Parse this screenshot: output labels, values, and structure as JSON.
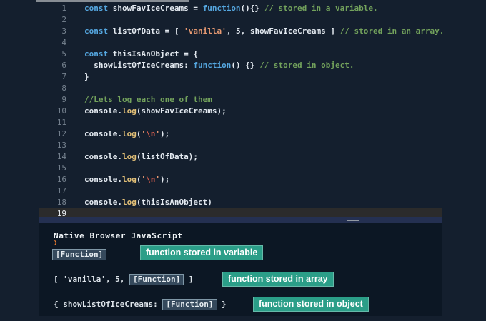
{
  "colors": {
    "page_bg": "#141f2e",
    "console_bg": "#0c1724",
    "active_line_bg": "#2b2b2b",
    "keyword": "#55a7e0",
    "plain_text": "#e3e9f0",
    "comment": "#73a25c",
    "string": "#e89a72",
    "escape": "#d95f4e",
    "method": "#e3c077",
    "badge_bg": "#2b9e88",
    "prompt_icon": "#ee7c2e"
  },
  "editor": {
    "lines": [
      {
        "num": "1",
        "tokens": [
          [
            "kw",
            "const"
          ],
          [
            "pl",
            " showFavIceCreams = "
          ],
          [
            "kw",
            "function"
          ],
          [
            "pl",
            "(){} "
          ],
          [
            "cm",
            "// stored in a variable."
          ]
        ]
      },
      {
        "num": "2",
        "tokens": []
      },
      {
        "num": "3",
        "tokens": [
          [
            "kw",
            "const"
          ],
          [
            "pl",
            " listOfData = [ "
          ],
          [
            "st",
            "'vanilla'"
          ],
          [
            "pl",
            ", 5, showFavIceCreams ] "
          ],
          [
            "cm",
            "// stored in an array."
          ]
        ]
      },
      {
        "num": "4",
        "tokens": []
      },
      {
        "num": "5",
        "tokens": [
          [
            "kw",
            "const"
          ],
          [
            "pl",
            " thisIsAnObject = {"
          ]
        ]
      },
      {
        "num": "6",
        "tokens": [
          [
            "pl",
            "  showListOfIceCreams: "
          ],
          [
            "kw",
            "function"
          ],
          [
            "pl",
            "() {} "
          ],
          [
            "cm",
            "// stored in object."
          ]
        ]
      },
      {
        "num": "7",
        "tokens": [
          [
            "pl",
            "}"
          ]
        ]
      },
      {
        "num": "8",
        "tokens": []
      },
      {
        "num": "9",
        "tokens": [
          [
            "cm",
            "//Lets log each one of them"
          ]
        ]
      },
      {
        "num": "10",
        "tokens": [
          [
            "pl",
            "console."
          ],
          [
            "fn",
            "log"
          ],
          [
            "pl",
            "(showFavIceCreams);"
          ]
        ]
      },
      {
        "num": "11",
        "tokens": []
      },
      {
        "num": "12",
        "tokens": [
          [
            "pl",
            "console."
          ],
          [
            "fn",
            "log"
          ],
          [
            "pl",
            "("
          ],
          [
            "st",
            "'"
          ],
          [
            "esc",
            "\\n"
          ],
          [
            "st",
            "'"
          ],
          [
            "pl",
            ");"
          ]
        ]
      },
      {
        "num": "13",
        "tokens": []
      },
      {
        "num": "14",
        "tokens": [
          [
            "pl",
            "console."
          ],
          [
            "fn",
            "log"
          ],
          [
            "pl",
            "(listOfData);"
          ]
        ]
      },
      {
        "num": "15",
        "tokens": []
      },
      {
        "num": "16",
        "tokens": [
          [
            "pl",
            "console."
          ],
          [
            "fn",
            "log"
          ],
          [
            "pl",
            "("
          ],
          [
            "st",
            "'"
          ],
          [
            "esc",
            "\\n"
          ],
          [
            "st",
            "'"
          ],
          [
            "pl",
            ");"
          ]
        ]
      },
      {
        "num": "17",
        "tokens": []
      },
      {
        "num": "18",
        "tokens": [
          [
            "pl",
            "console."
          ],
          [
            "fn",
            "log"
          ],
          [
            "pl",
            "(thisIsAnObject)"
          ]
        ]
      },
      {
        "num": "19",
        "tokens": [],
        "active": true
      }
    ]
  },
  "console": {
    "title": "Native Browser JavaScript",
    "prompt": "❯",
    "outputs": [
      {
        "prefix": "",
        "boxed": "[Function]",
        "suffix": ""
      },
      {
        "prefix": "[ 'vanilla', 5, ",
        "boxed": "[Function]",
        "suffix": " ]"
      },
      {
        "prefix": "{ showListOfIceCreams: ",
        "boxed": "[Function]",
        "suffix": " }"
      }
    ],
    "badges": [
      {
        "label": "function stored in variable"
      },
      {
        "label": "function stored in array"
      },
      {
        "label": "function stored in object"
      }
    ]
  }
}
